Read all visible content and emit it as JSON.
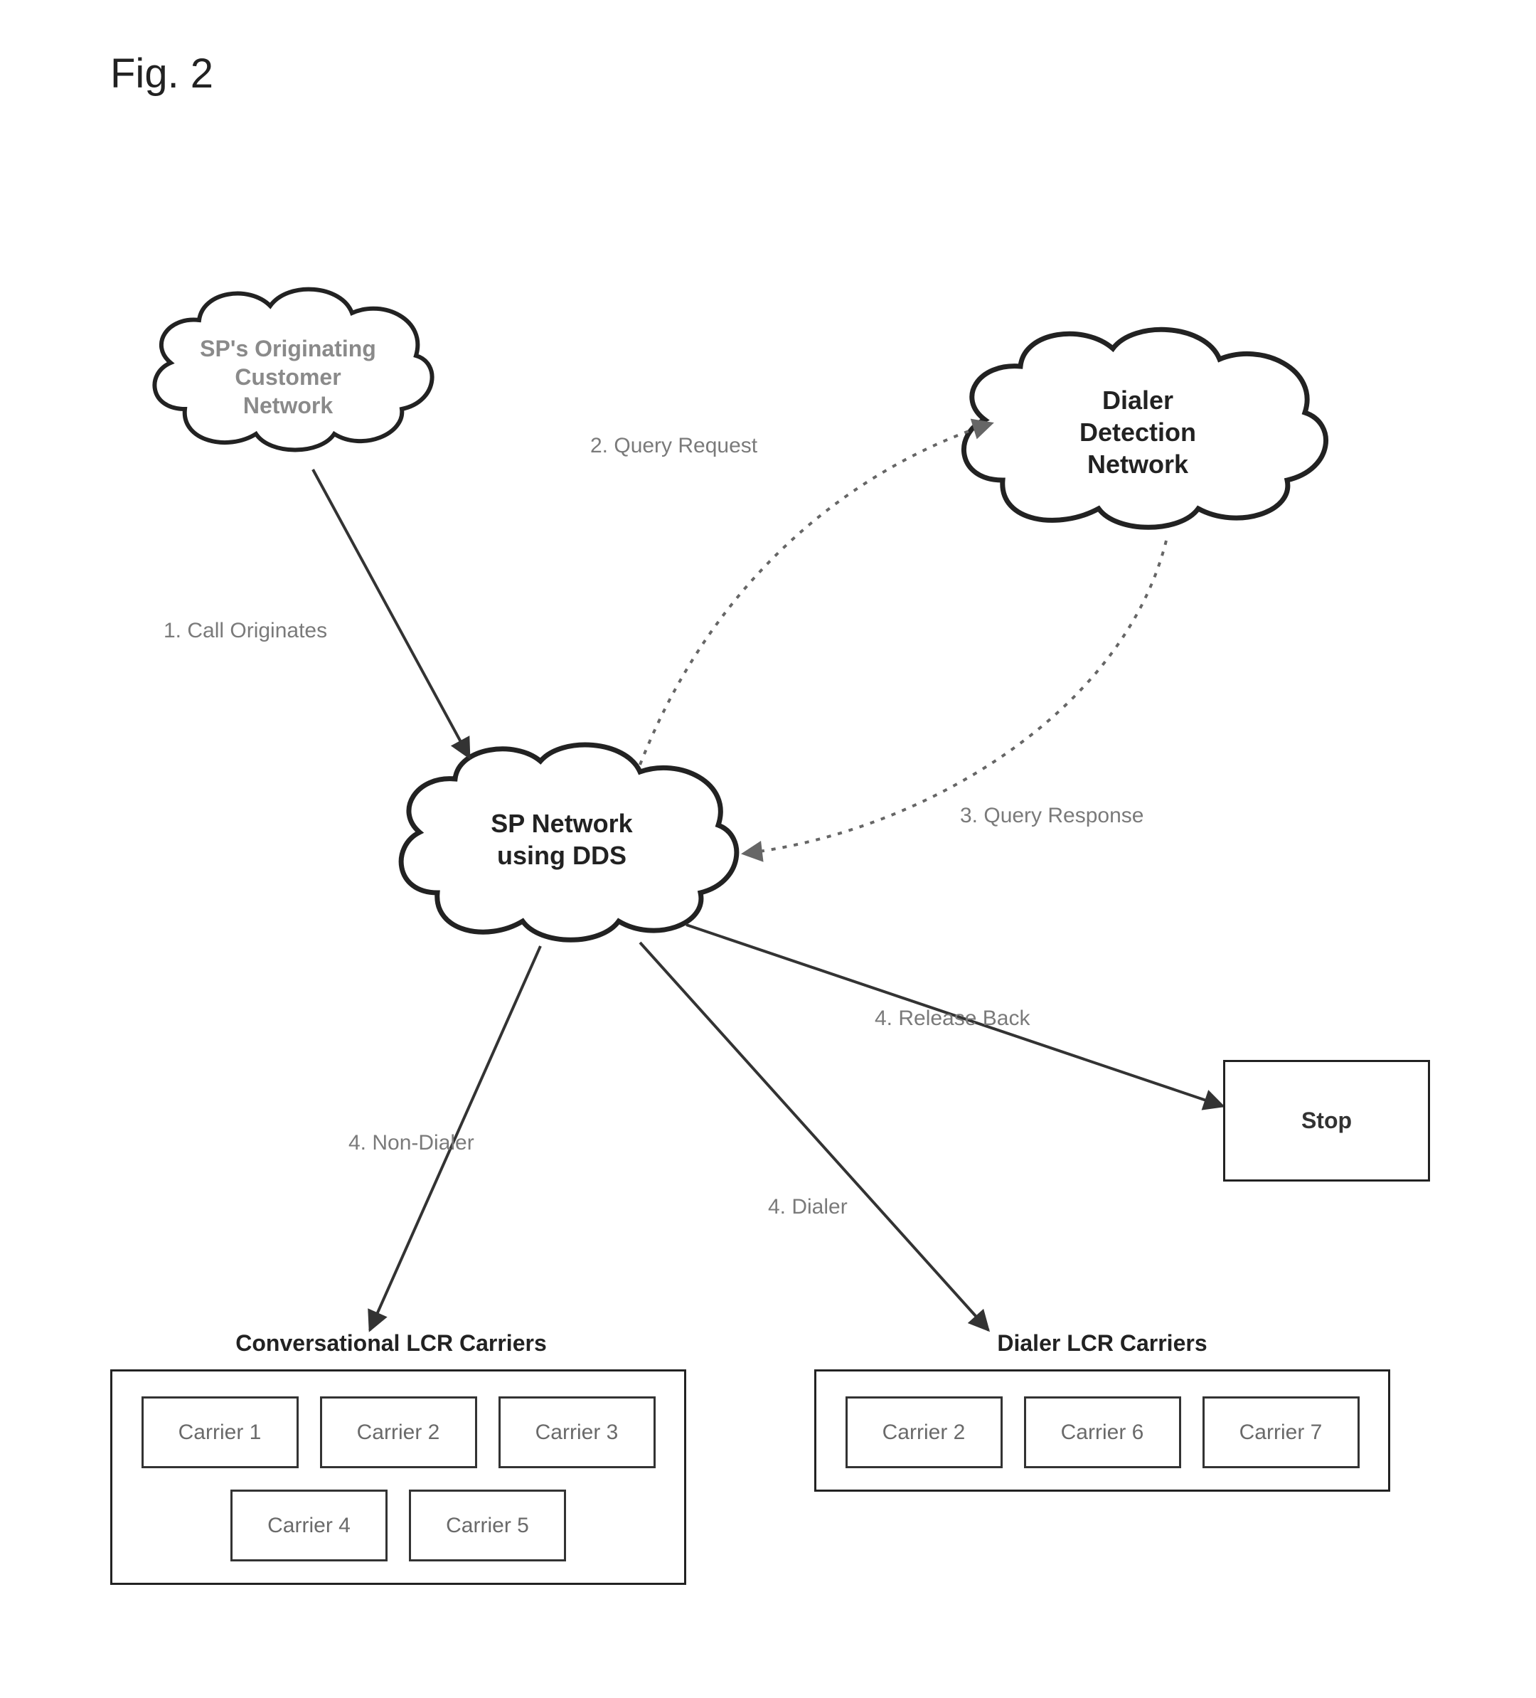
{
  "figure_title": "Fig. 2",
  "clouds": {
    "origin": {
      "lines": [
        "SP's Originating",
        "Customer",
        "Network"
      ]
    },
    "ddn": {
      "lines": [
        "Dialer",
        "Detection",
        "Network"
      ]
    },
    "sp": {
      "lines": [
        "SP Network",
        "using DDS"
      ]
    }
  },
  "edges": {
    "e1": "1.  Call Originates",
    "e2": "2.  Query Request",
    "e3": "3.  Query Response",
    "e4a": "4.  Non-Dialer",
    "e4b": "4.  Dialer",
    "e4c": "4.  Release Back"
  },
  "stop": "Stop",
  "groups": {
    "conv": {
      "title": "Conversational LCR Carriers",
      "carriers": [
        "Carrier 1",
        "Carrier 2",
        "Carrier 3",
        "Carrier 4",
        "Carrier 5"
      ]
    },
    "dialer": {
      "title": "Dialer LCR Carriers",
      "carriers": [
        "Carrier 2",
        "Carrier 6",
        "Carrier 7"
      ]
    }
  }
}
